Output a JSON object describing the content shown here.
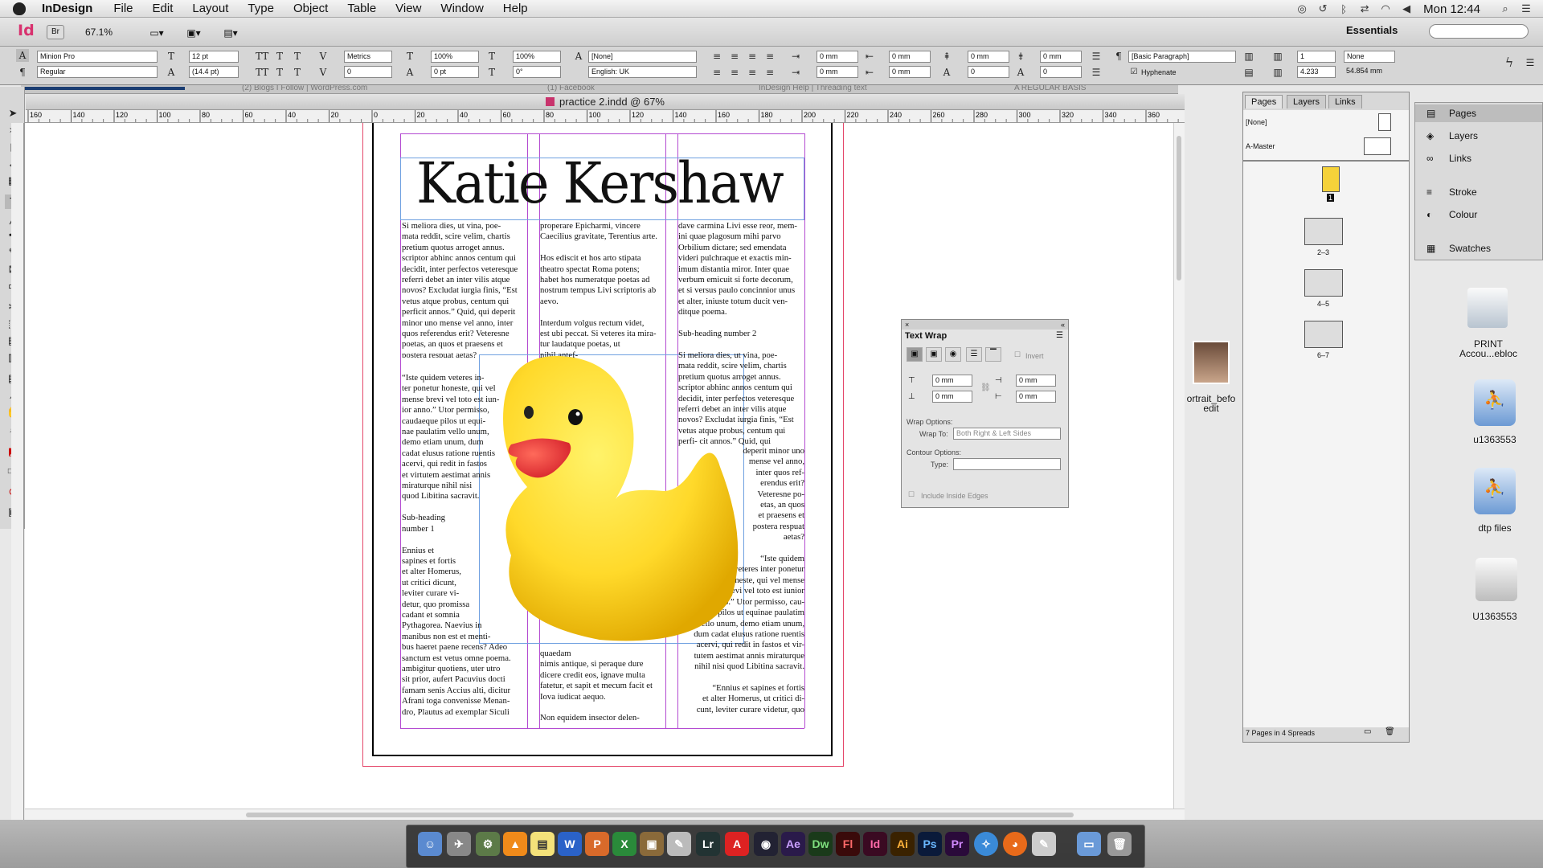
{
  "menubar": {
    "app": "InDesign",
    "items": [
      "File",
      "Edit",
      "Layout",
      "Type",
      "Object",
      "Table",
      "View",
      "Window",
      "Help"
    ],
    "clock": "Mon 12:44"
  },
  "appbar": {
    "logo": "Id",
    "bridge": "Br",
    "zoom": "67.1%",
    "workspace": "Essentials"
  },
  "control": {
    "font": "Minion Pro",
    "style": "Regular",
    "size": "12 pt",
    "leading": "(14.4 pt)",
    "kerning": "Metrics",
    "tracking": "0",
    "hscale": "100%",
    "vscale": "100%",
    "baseline": "0 pt",
    "skew": "0°",
    "charstyle": "[None]",
    "language": "English: UK",
    "indent1": "0 mm",
    "indent2": "0 mm",
    "indent3": "0 mm",
    "indent4": "0 mm",
    "space1": "0 mm",
    "space2": "0 mm",
    "drop1": "0",
    "drop2": "0",
    "parastyle": "[Basic Paragraph]",
    "hyphenate": "Hyphenate",
    "cols": "1",
    "colw": "4.233",
    "none": "None",
    "gutter": "54.854 mm"
  },
  "tabs": [
    "(2) Blogs I Follow | WordPress.com",
    "(1) Facebook",
    "InDesign Help | Threading text",
    "A REGULAR BASIS"
  ],
  "document": {
    "title": "practice 2.indd @ 67%"
  },
  "ruler": {
    "labels": [
      "160",
      "140",
      "120",
      "100",
      "80",
      "60",
      "40",
      "20",
      "0",
      "20",
      "40",
      "60",
      "80",
      "100",
      "120",
      "140",
      "160",
      "180",
      "200",
      "220",
      "240",
      "260",
      "280",
      "300",
      "320",
      "340",
      "360"
    ]
  },
  "page": {
    "heading": "Katie Kershaw",
    "col1a": "Si meliora dies, ut vina, poe-\nmata reddit, scire velim, chartis\npretium quotus arroget annus.\nscriptor abhinc annos centum qui\ndecidit, inter perfectos veteresque\nreferri debet an inter vilis atque\nnovos? Excludat iurgia finis, “Est\nvetus atque probus, centum qui\nperficit annos.” Quid, qui deperit\nminor uno mense vel anno, inter\nquos referendus erit? Veteresne\npoetas, an quos et praesens et\npostera respuat aetas?",
    "col1b": "“Iste quidem veteres in-\nter ponetur honeste, qui vel\nmense brevi vel toto est iun-\nior anno.” Utor permisso,\ncaudaeque pilos ut equi-\nnae paulatim vello unum,\ndemo etiam unum, dum\ncadat elusus ratione ruentis\nacervi, qui redit in fastos\net virtutem aestimat annis\nmiraturque nihil nisi\nquod Libitina sacravit.\n\nSub-heading\nnumber 1\n\nEnnius et\nsapines et fortis\net alter Homerus,\nut critici dicunt,\nleviter curare vi-\ndetur, quo promissa\ncadant et somnia\nPythagorea. Naevius in\nmanibus non est et menti-\nbus haeret paene recens? Adeo\nsanctum est vetus omne poema.\nambigitur quotiens, uter utro\nsit prior, aufert Pacuvius docti\nfamam senis Accius alti, dicitur\nAfrani toga convenisse Menan-\ndro, Plautus ad exemplar Siculi",
    "col2a": "properare Epicharmi, vincere\nCaecilius gravitate, Terentius arte.\n\nHos ediscit et hos arto stipata\ntheatro spectat Roma potens;\nhabet hos numeratque poetas ad\nnostrum tempus Livi scriptoris ab\naevo.\n\nInterdum volgus rectum videt,\nest ubi peccat. Si veteres ita mira-\ntur        laudatque poetas, ut\n             nihil antef-\n               erat, nihil\n                 illis com-\n                    paret,\n                     errat. Si",
    "col2b": "quaedam\nnimis antique, si peraque dure\ndicere credit eos, ignave multa\nfatetur, et sapit et mecum facit et\nIova iudicat aequo.\n\nNon equidem insector delen-",
    "col3a": "dave carmina Livi esse reor, mem-\nini quae plagosum mihi parvo\nOrbilium dictare; sed emendata\nvideri pulchraque et exactis min-\nimum distantia miror. Inter quae\nverbum emicuit si forte decorum,\net si versus paulo concinnior unus\net alter, iniuste totum ducit ven-\nditque poema.\n\nSub-heading number 2\n\nSi meliora dies, ut vina, poe-\nmata reddit, scire velim, chartis\npretium quotus arroget annus.\nscriptor abhinc annos centum qui\ndecidit, inter perfectos veteresque\nreferri debet an inter vilis atque\nnovos? Excludat iurgia finis, “Est\nvetus atque probus, centum qui\nperfi-         cit annos.” Quid, qui",
    "col3b": "deperit minor uno\nmense vel anno,\ninter quos ref-\nerendus erit?\nVeteresne po-\netas, an quos\net praesens et\npostera respuat\naetas?\n\n“Iste quidem\nveteres inter ponetur\nhoneste, qui vel mense\nbrevi vel toto est iunior\nanno.” Utor permisso, cau-\ndaeque pilos ut equinae paulatim\nvello unum, demo etiam unum,\ndum cadat elusus ratione ruentis\nacervi, qui redit in fastos et vir-\ntutem aestimat annis miraturque\nnihil nisi quod Libitina sacravit.\n\n“Ennius et sapines et fortis\net alter Homerus, ut critici di-\ncunt, leviter curare videtur, quo"
  },
  "pages_panel": {
    "tabs": [
      "Pages",
      "Layers",
      "Links"
    ],
    "none": "[None]",
    "master": "A-Master",
    "labels": [
      "1",
      "2–3",
      "4–5",
      "6–7"
    ],
    "footer": "7 Pages in 4 Spreads"
  },
  "icon_panel": {
    "items": [
      "Pages",
      "Layers",
      "Links",
      "Stroke",
      "Colour",
      "Swatches"
    ]
  },
  "textwrap": {
    "title": "Text Wrap",
    "invert": "Invert",
    "top": "0 mm",
    "bottom": "0 mm",
    "left": "0 mm",
    "right": "0 mm",
    "wrap_options": "Wrap Options:",
    "wrap_to_label": "Wrap To:",
    "wrap_to": "Both Right & Left Sides",
    "contour": "Contour Options:",
    "type_label": "Type:",
    "inside": "Include Inside Edges"
  },
  "desktop": {
    "items": [
      "ortrait_befo\nedit",
      "PRINT\nAccou...ebloc",
      "u1363553",
      "dtp files",
      "U1363553"
    ]
  },
  "dock": {
    "apps": [
      "Lr",
      "Ae",
      "Dw",
      "Fl",
      "Id",
      "Ai",
      "Ps",
      "Pr"
    ]
  }
}
